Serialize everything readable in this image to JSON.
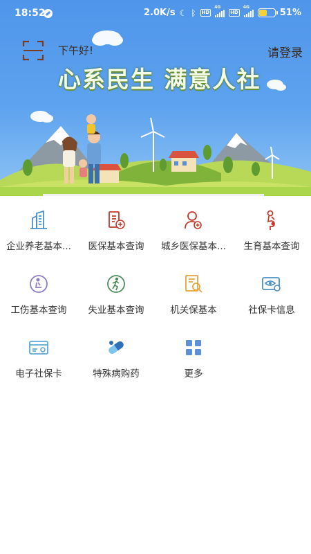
{
  "status_bar": {
    "time": "18:52",
    "network_speed": "2.0K/s",
    "hd_badge_1": "HD",
    "net_type_1": "4G",
    "hd_badge_2": "HD",
    "net_type_2": "4G",
    "battery_percent": "51%",
    "battery_level": 0.51,
    "battery_color": "#f6d23a"
  },
  "header": {
    "greeting": "下午好!",
    "login_label": "请登录",
    "slogan": "心系民生  满意人社",
    "scan_icon": "scan-icon"
  },
  "services": [
    {
      "label": "企业养老基本...",
      "icon": "building-icon",
      "color": "#4a90c8"
    },
    {
      "label": "医保基本查询",
      "icon": "medical-doc-icon",
      "color": "#c0392b"
    },
    {
      "label": "城乡医保基本...",
      "icon": "person-medical-icon",
      "color": "#c0392b"
    },
    {
      "label": "生育基本查询",
      "icon": "pregnancy-icon",
      "color": "#c0392b"
    },
    {
      "label": "工伤基本查询",
      "icon": "injury-icon",
      "color": "#8e7cc3"
    },
    {
      "label": "失业基本查询",
      "icon": "unemployment-icon",
      "color": "#4f8a5b"
    },
    {
      "label": "机关保基本",
      "icon": "document-search-icon",
      "color": "#e8a33d"
    },
    {
      "label": "社保卡信息",
      "icon": "card-eye-icon",
      "color": "#4a90c8"
    },
    {
      "label": "电子社保卡",
      "icon": "e-card-icon",
      "color": "#5aa9d6"
    },
    {
      "label": "特殊病购药",
      "icon": "pill-icon",
      "color": "#3d8fd1"
    },
    {
      "label": "更多",
      "icon": "grid-more-icon",
      "color": "#5b8fd6"
    }
  ]
}
